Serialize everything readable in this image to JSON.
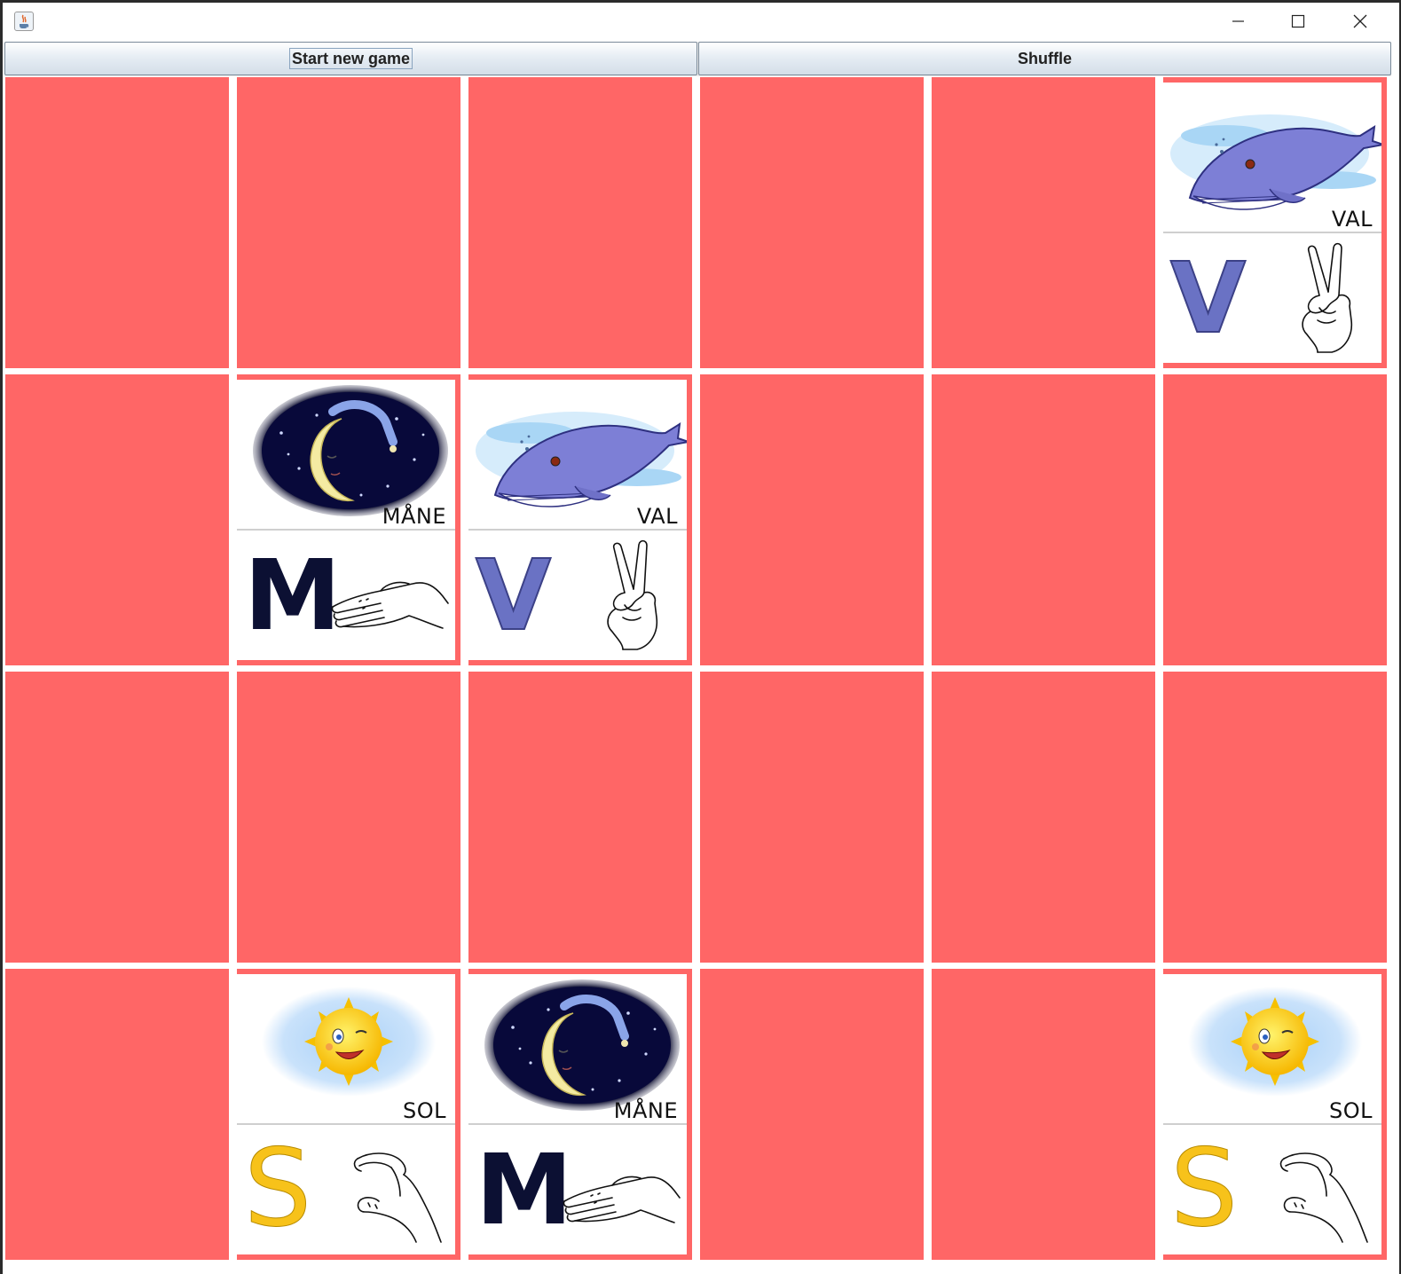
{
  "window": {
    "controls": {
      "minimize_icon": "minimize-icon",
      "maximize_icon": "maximize-icon",
      "close_icon": "close-icon"
    }
  },
  "toolbar": {
    "start_label": "Start new game",
    "shuffle_label": "Shuffle"
  },
  "card_back_color": "#ff6666",
  "cards": [
    {
      "state": "hidden"
    },
    {
      "state": "hidden"
    },
    {
      "state": "hidden"
    },
    {
      "state": "hidden"
    },
    {
      "state": "hidden"
    },
    {
      "state": "revealed",
      "word": "VAL",
      "letter": "V",
      "picture": "whale"
    },
    {
      "state": "hidden"
    },
    {
      "state": "revealed",
      "word": "MÅNE",
      "letter": "M",
      "picture": "moon"
    },
    {
      "state": "revealed",
      "word": "VAL",
      "letter": "V",
      "picture": "whale"
    },
    {
      "state": "hidden"
    },
    {
      "state": "hidden"
    },
    {
      "state": "hidden"
    },
    {
      "state": "hidden"
    },
    {
      "state": "hidden"
    },
    {
      "state": "hidden"
    },
    {
      "state": "hidden"
    },
    {
      "state": "hidden"
    },
    {
      "state": "hidden"
    },
    {
      "state": "hidden"
    },
    {
      "state": "revealed",
      "word": "SOL",
      "letter": "S",
      "picture": "sun"
    },
    {
      "state": "revealed",
      "word": "MÅNE",
      "letter": "M",
      "picture": "moon"
    },
    {
      "state": "hidden"
    },
    {
      "state": "hidden"
    },
    {
      "state": "revealed",
      "word": "SOL",
      "letter": "S",
      "picture": "sun"
    }
  ]
}
